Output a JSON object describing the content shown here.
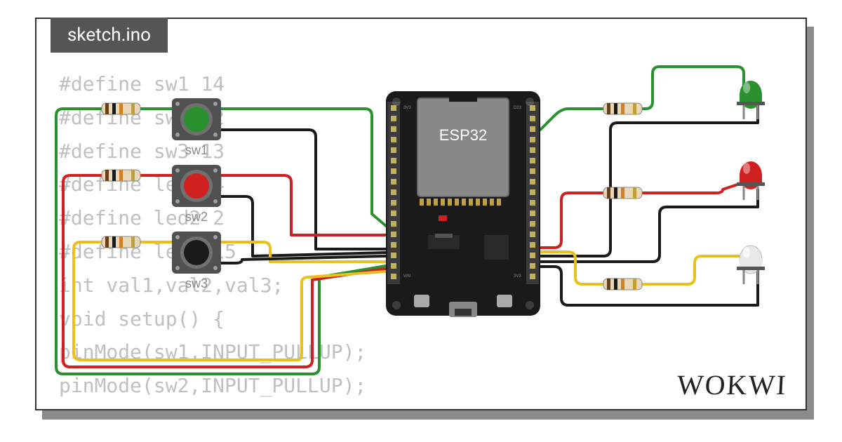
{
  "tab": {
    "label": "sketch.ino"
  },
  "code": {
    "lines": [
      "#define sw1 14",
      "#define sw2 12",
      "#define sw3 13",
      "#define led1 4",
      "#define led2 2",
      "#define led3 15",
      "int val1,val2,val3;",
      "void setup() {",
      "  pinMode(sw1,INPUT_PULLUP);",
      "  pinMode(sw2,INPUT_PULLUP);"
    ]
  },
  "components": {
    "sw1": {
      "label": "sw1",
      "color": "#2a9030"
    },
    "sw2": {
      "label": "sw2",
      "color": "#d02020"
    },
    "sw3": {
      "label": "sw3",
      "color": "#1a1a1a"
    },
    "esp32": {
      "label": "ESP32"
    },
    "led_green": {
      "color": "#2a9030"
    },
    "led_red": {
      "color": "#d02020"
    },
    "led_white": {
      "color": "#f0f0f0"
    }
  },
  "wire_colors": {
    "green": "#2a9030",
    "red": "#d02020",
    "black": "#1a1a1a",
    "yellow": "#e8c020"
  },
  "branding": {
    "logo": "WOKWI"
  }
}
